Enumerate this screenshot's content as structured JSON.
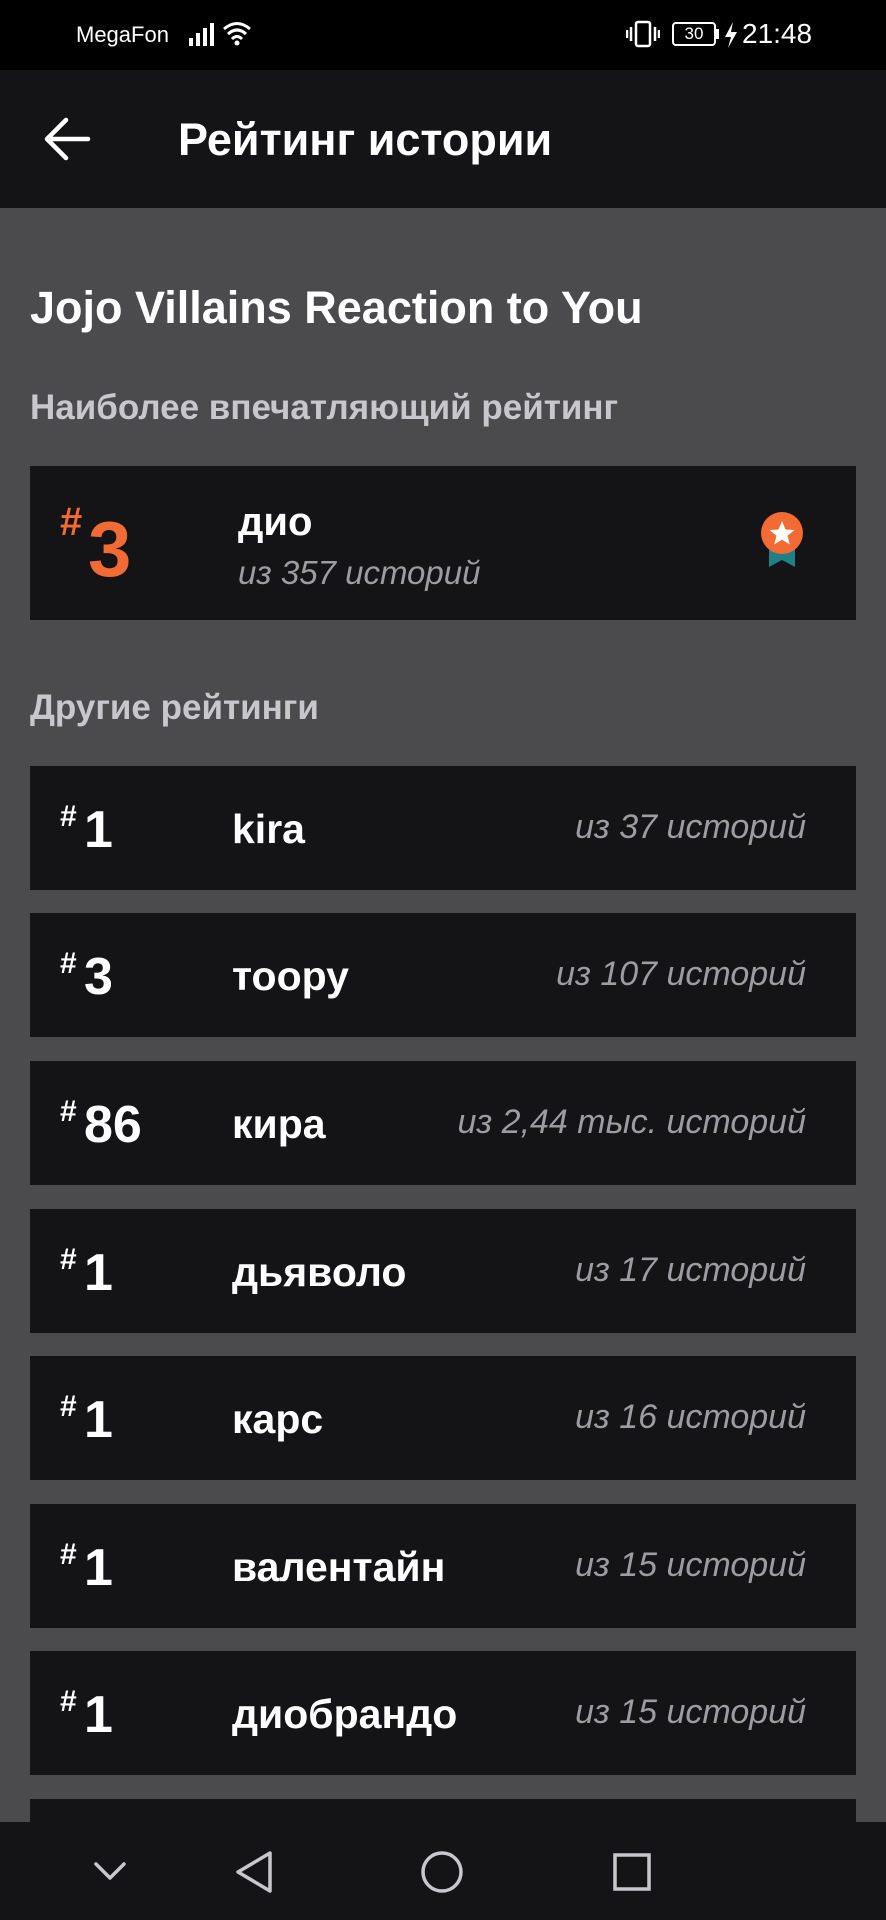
{
  "status_bar": {
    "carrier": "MegaFon",
    "battery": "30",
    "time": "21:48"
  },
  "app_bar": {
    "title": "Рейтинг истории",
    "back_icon": "arrow-left-icon"
  },
  "story": {
    "title": "Jojo Villains Reaction to You"
  },
  "sections": {
    "top_label": "Наиболее впечатляющий рейтинг",
    "other_label": "Другие рейтинги"
  },
  "top_rank": {
    "hash": "#",
    "rank": "3",
    "tag": "дио",
    "count": "из 357 историй",
    "badge_icon": "medal-star-icon",
    "accent": "#f26b35"
  },
  "other_ranks": [
    {
      "hash": "#",
      "rank": "1",
      "tag": "kira",
      "count": "из 37 историй"
    },
    {
      "hash": "#",
      "rank": "3",
      "tag": "тоору",
      "count": "из 107 историй"
    },
    {
      "hash": "#",
      "rank": "86",
      "tag": "кира",
      "count": "из 2,44 тыс. историй"
    },
    {
      "hash": "#",
      "rank": "1",
      "tag": "дьяволо",
      "count": "из 17 историй"
    },
    {
      "hash": "#",
      "rank": "1",
      "tag": "карс",
      "count": "из 16 историй"
    },
    {
      "hash": "#",
      "rank": "1",
      "tag": "валентайн",
      "count": "из 15 историй"
    },
    {
      "hash": "#",
      "rank": "1",
      "tag": "диобрандо",
      "count": "из 15 историй"
    }
  ],
  "nav_bar": {
    "icons": [
      "chevron-down-icon",
      "back-triangle-icon",
      "home-circle-icon",
      "recents-square-icon"
    ]
  }
}
